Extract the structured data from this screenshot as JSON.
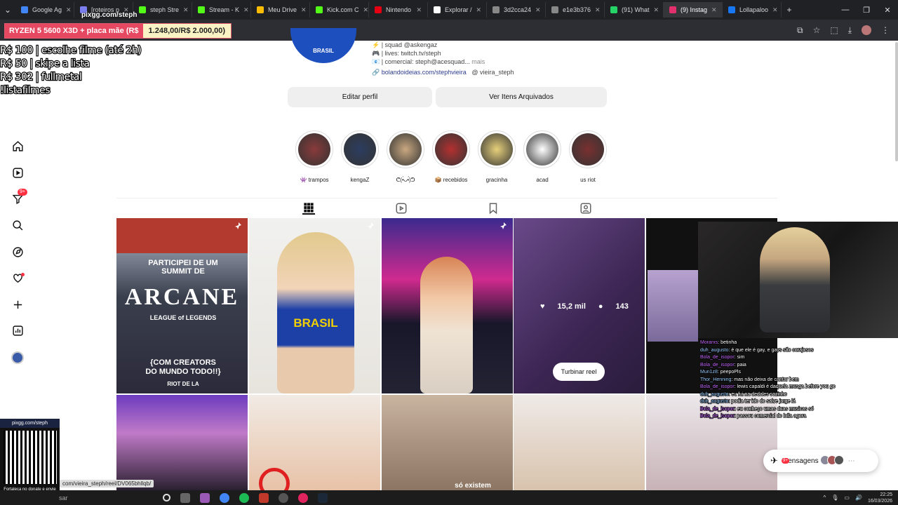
{
  "browser": {
    "tabs": [
      {
        "label": "Google Ag",
        "color": "#4285f4"
      },
      {
        "label": "[roteiros p",
        "color": "#7b7ff0"
      },
      {
        "label": "steph Stre",
        "color": "#53fc18"
      },
      {
        "label": "Stream - K",
        "color": "#53fc18"
      },
      {
        "label": "Meu Drive",
        "color": "#fbbc04"
      },
      {
        "label": "Kick.com C",
        "color": "#53fc18"
      },
      {
        "label": "Nintendo",
        "color": "#e60012"
      },
      {
        "label": "Explorar /",
        "color": "#ffffff"
      },
      {
        "label": "3d2cca24",
        "color": "#888888"
      },
      {
        "label": "e1e3b376",
        "color": "#888888"
      },
      {
        "label": "(91) What",
        "color": "#25d366"
      },
      {
        "label": "(9) Instag",
        "color": "#e1306c"
      },
      {
        "label": "Lollapaloo",
        "color": "#1877f2"
      }
    ],
    "new_tab": "+"
  },
  "overlay": {
    "pix_top": "pixgg.com/steph",
    "banner_left": "RYZEN 5 5600 X3D + placa mãe (R$",
    "banner_right": "1.248,00/R$ 2.000,00)",
    "donations": [
      "R$ 100 | escolhe filme (até 2h)",
      "R$ 50 | skipe a lista",
      "R$ 302 | fullmetal",
      "!listafilmes"
    ],
    "qr_title": "pixgg.com/steph",
    "qr_caption": "Fortaleça no donate e envie sua mensagem!"
  },
  "profile": {
    "pic_text": "BRASIL",
    "bio_lines": [
      "⚡ | squad @askengaz",
      "🎮 | lives: twitch.tv/steph",
      "📧 | comercial: steph@acesquad..."
    ],
    "more": "mais",
    "link": "bolandoideias.com/stephvieira",
    "threads": "vieira_steph",
    "edit_button": "Editar perfil",
    "archive_button": "Ver Itens Arquivados"
  },
  "highlights": [
    {
      "label": "👾 trampos",
      "color": "#8a3a3a"
    },
    {
      "label": "kengaZ",
      "color": "#2c3d60"
    },
    {
      "label": "ᕦ(•̀ᴗ•́)ᕤ",
      "color": "#c9a880"
    },
    {
      "label": "📦 recebidos",
      "color": "#b43030"
    },
    {
      "label": "gracinha",
      "color": "#e7d07a"
    },
    {
      "label": "acad",
      "color": "#ffffff"
    },
    {
      "label": "us riot",
      "color": "#7a3030"
    }
  ],
  "posts": {
    "arcane_lines": [
      "PARTICIPEI DE UM",
      "SUMMIT DE",
      "ARCANE",
      "LEAGUE of LEGENDS",
      "{COM CREATORS",
      "DO MUNDO TODO!!}",
      "RIOT DE LA"
    ],
    "brasil_shirt": "BRASIL",
    "likes": "15,2 mil",
    "comments": "143",
    "boost_button": "Turbinar reel",
    "bottom_caption": "só existem"
  },
  "chat": [
    {
      "user": "Morarxs",
      "msg": "betinha"
    },
    {
      "user": "duh_augusto",
      "msg": "é que ele é gay, e gays são corajosos"
    },
    {
      "user": "Bola_de_isopor",
      "msg": "sim"
    },
    {
      "user": "Bola_de_isopor",
      "msg": "paia"
    },
    {
      "user": "Mun1z8",
      "msg": "peepoPls"
    },
    {
      "user": "Thor_Henning",
      "msg": "mas não deixa de cantar bem"
    },
    {
      "user": "Bola_de_isopor",
      "msg": "lewis capaldi é daquela musga before you go"
    },
    {
      "user": "duh_augusto",
      "msg": "eu fui na dedales sozinho"
    },
    {
      "user": "duh_augusto",
      "msg": "podia ter ido do salve jorge lá"
    },
    {
      "user": "Bola_de_isopor",
      "msg": "eu conheço umas duas musicas só"
    },
    {
      "user": "Bola_de_isopor",
      "msg": "passou comercial do lolla agora"
    }
  ],
  "messages_pill": {
    "label": "Mensagens",
    "badge": "9+"
  },
  "nav": {
    "notif_badge": "9+"
  },
  "status_url": "com/vieira_steph/reel/DV065bhllqb/",
  "taskbar": {
    "search": "sar",
    "time": "22:25",
    "date": "16/03/2026"
  }
}
